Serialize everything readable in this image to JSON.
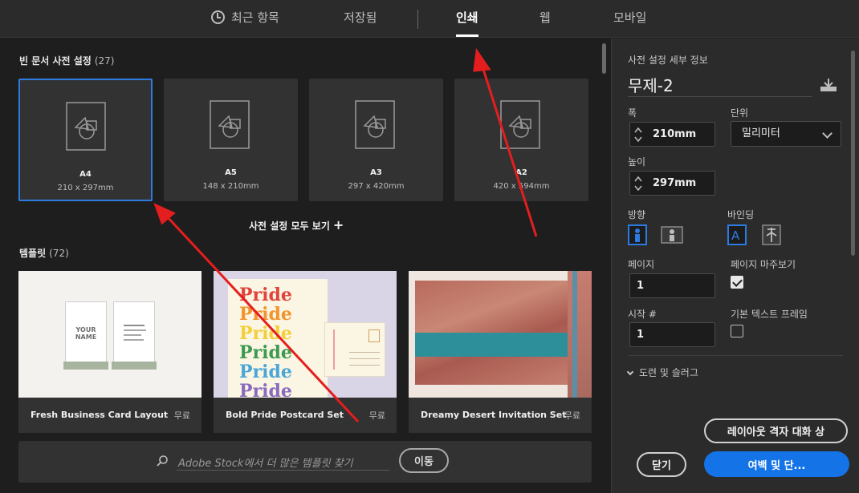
{
  "tabs": {
    "recent": "최근 항목",
    "saved": "저장됨",
    "print": "인쇄",
    "web": "웹",
    "mobile": "모바일"
  },
  "presets": {
    "title": "빈 문서 사전 설정",
    "count": "(27)",
    "items": [
      {
        "name": "A4",
        "dims": "210 x 297mm"
      },
      {
        "name": "A5",
        "dims": "148 x 210mm"
      },
      {
        "name": "A3",
        "dims": "297 x 420mm"
      },
      {
        "name": "A2",
        "dims": "420 x 594mm"
      }
    ],
    "view_all": "사전 설정 모두 보기"
  },
  "templates": {
    "title": "템플릿",
    "count": "(72)",
    "items": [
      {
        "name": "Fresh Business Card Layout",
        "price": "무료",
        "card_text": "YOUR NAME"
      },
      {
        "name": "Bold Pride Postcard Set",
        "price": "무료",
        "pride_word": "Pride"
      },
      {
        "name": "Dreamy Desert Invitation Set",
        "price": "무료"
      }
    ]
  },
  "stock": {
    "placeholder": "Adobe Stock에서 더 많은 템플릿 찾기",
    "go": "이동"
  },
  "details": {
    "header": "사전 설정 세부 정보",
    "doc_name": "무제-2",
    "width_label": "폭",
    "width_value": "210mm",
    "unit_label": "단위",
    "unit_value": "밀리미터",
    "height_label": "높이",
    "height_value": "297mm",
    "orientation_label": "방향",
    "binding_label": "바인딩",
    "pages_label": "페이지",
    "pages_value": "1",
    "facing_label": "페이지 마주보기",
    "facing_checked": true,
    "start_label": "시작 #",
    "start_value": "1",
    "primary_frame_label": "기본 텍스트 프레임",
    "primary_frame_checked": false,
    "bleed_label": "도련 및 슬러그"
  },
  "buttons": {
    "layout_grid": "레이아웃 격자 대화 상",
    "close": "닫기",
    "margins": "여백 및 단..."
  },
  "colors": {
    "accent": "#1473e6",
    "selection": "#2d7be0",
    "annotation_arrow": "#e41e1e"
  }
}
